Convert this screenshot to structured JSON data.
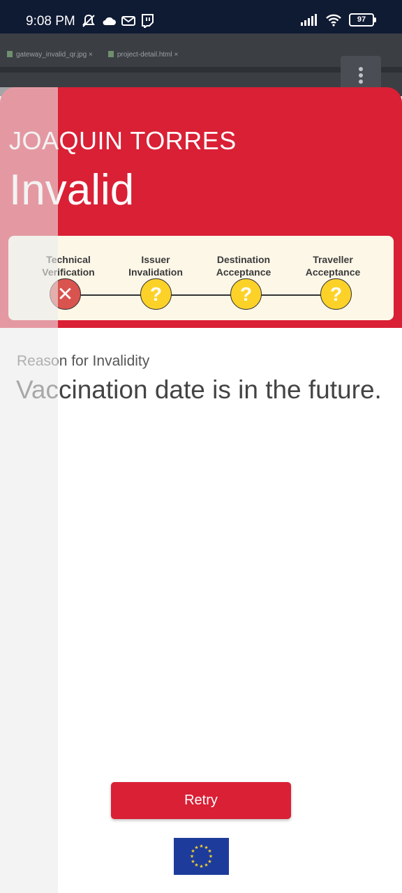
{
  "status_bar": {
    "time": "9:08 PM",
    "battery": "97",
    "icons_left": [
      "mute-icon",
      "cloud-icon",
      "mail-icon",
      "twitch-icon"
    ],
    "icons_right": [
      "signal-icon",
      "wifi-icon",
      "battery-icon"
    ]
  },
  "background_app": {
    "tabs": [
      "gateway_invalid_qr.jpg",
      "project-detail.html"
    ]
  },
  "header": {
    "holder_name": "JOAQUIN TORRES",
    "status": "Invalid",
    "color": "#d92035"
  },
  "steps": [
    {
      "line1": "Technical",
      "line2": "Verification",
      "state": "failed",
      "glyph": "✕"
    },
    {
      "line1": "Issuer",
      "line2": "Invalidation",
      "state": "unknown",
      "glyph": "?"
    },
    {
      "line1": "Destination",
      "line2": "Acceptance",
      "state": "unknown",
      "glyph": "?"
    },
    {
      "line1": "Traveller",
      "line2": "Acceptance",
      "state": "unknown",
      "glyph": "?"
    }
  ],
  "reason": {
    "label": "Reason for Invalidity",
    "text": "Vaccination date is in the future."
  },
  "actions": {
    "retry_label": "Retry"
  },
  "footer": {
    "flag": "eu-flag-icon"
  }
}
